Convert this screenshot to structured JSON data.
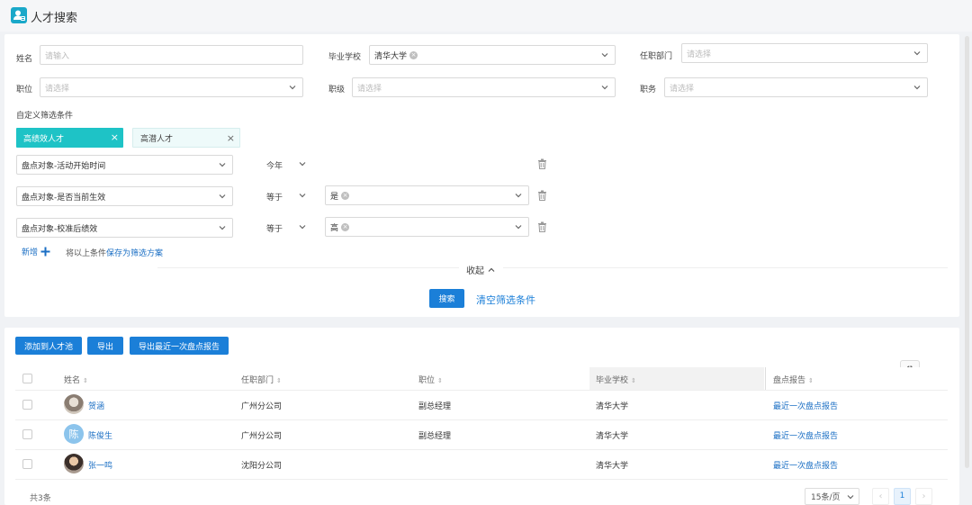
{
  "app": {
    "title": "人才搜索",
    "logo_icon": "user-card-icon"
  },
  "filters": {
    "name": {
      "label": "姓名",
      "placeholder": "请输入"
    },
    "school": {
      "label": "毕业学校",
      "value": "清华大学"
    },
    "department": {
      "label": "任职部门",
      "placeholder": "请选择"
    },
    "position": {
      "label": "职位",
      "placeholder": "请选择"
    },
    "rank": {
      "label": "职级",
      "placeholder": "请选择"
    },
    "duty": {
      "label": "职务",
      "placeholder": "请选择"
    },
    "custom_label": "自定义筛选条件",
    "tags": [
      {
        "label": "高绩效人才",
        "active": true
      },
      {
        "label": "高潜人才",
        "active": false
      }
    ],
    "conditions": [
      {
        "field": "盘点对象-活动开始时间",
        "operator": "今年",
        "value": ""
      },
      {
        "field": "盘点对象-是否当前生效",
        "operator": "等于",
        "value": "是"
      },
      {
        "field": "盘点对象-校准后绩效",
        "operator": "等于",
        "value": "高"
      }
    ],
    "add_label": "新增",
    "save_prefix": "将以上条件",
    "save_link": "保存为筛选方案",
    "collapse_label": "收起",
    "search_button": "搜索",
    "clear_link": "清空筛选条件"
  },
  "toolbar": {
    "add_pool": "添加到人才池",
    "export": "导出",
    "export_report": "导出最近一次盘点报告"
  },
  "table": {
    "columns": [
      "姓名",
      "任职部门",
      "职位",
      "毕业学校",
      "盘点报告"
    ],
    "rows": [
      {
        "name": "贺涵",
        "avatar_text": "",
        "dept": "广州分公司",
        "position": "副总经理",
        "school": "清华大学",
        "report": "最近一次盘点报告"
      },
      {
        "name": "陈俊生",
        "avatar_text": "陈",
        "dept": "广州分公司",
        "position": "副总经理",
        "school": "清华大学",
        "report": "最近一次盘点报告"
      },
      {
        "name": "张一鸣",
        "avatar_text": "",
        "dept": "沈阳分公司",
        "position": "",
        "school": "清华大学",
        "report": "最近一次盘点报告"
      }
    ]
  },
  "pagination": {
    "total": "共3条",
    "page_size": "15条/页",
    "current_page": "1"
  },
  "colors": {
    "accent": "#1b7fd8",
    "tag_active": "#1ec3c6",
    "tag_inactive": "#eefafa"
  }
}
